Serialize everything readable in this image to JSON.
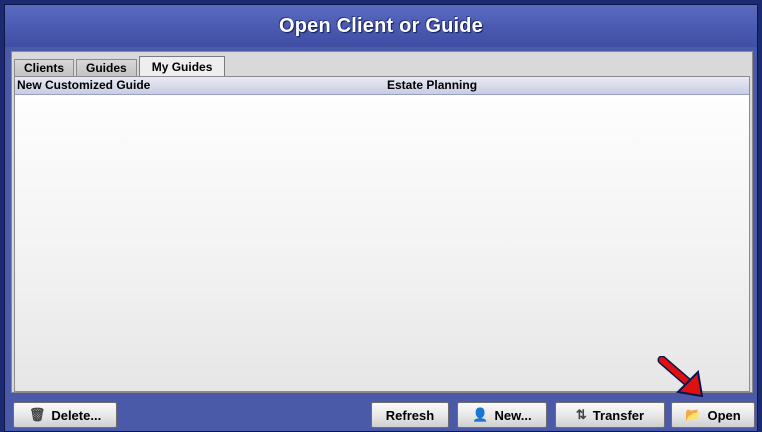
{
  "window": {
    "title": "Open Client or Guide"
  },
  "tabs": [
    {
      "label": "Clients",
      "active": false
    },
    {
      "label": "Guides",
      "active": false
    },
    {
      "label": "My Guides",
      "active": true
    }
  ],
  "list": {
    "columns": [
      "New Customized Guide",
      "Estate Planning"
    ],
    "rows": []
  },
  "buttons": {
    "delete": {
      "label": "Delete...",
      "icon": "trash-icon"
    },
    "refresh": {
      "label": "Refresh"
    },
    "new": {
      "label": "New...",
      "icon": "new-user-icon"
    },
    "transfer": {
      "label": "Transfer",
      "icon": "transfer-icon"
    },
    "open": {
      "label": "Open",
      "icon": "open-folder-icon"
    }
  },
  "colors": {
    "window_bg": "#4a5aa8",
    "outer_bg": "#1c2a72",
    "arrow": "#e01010"
  }
}
